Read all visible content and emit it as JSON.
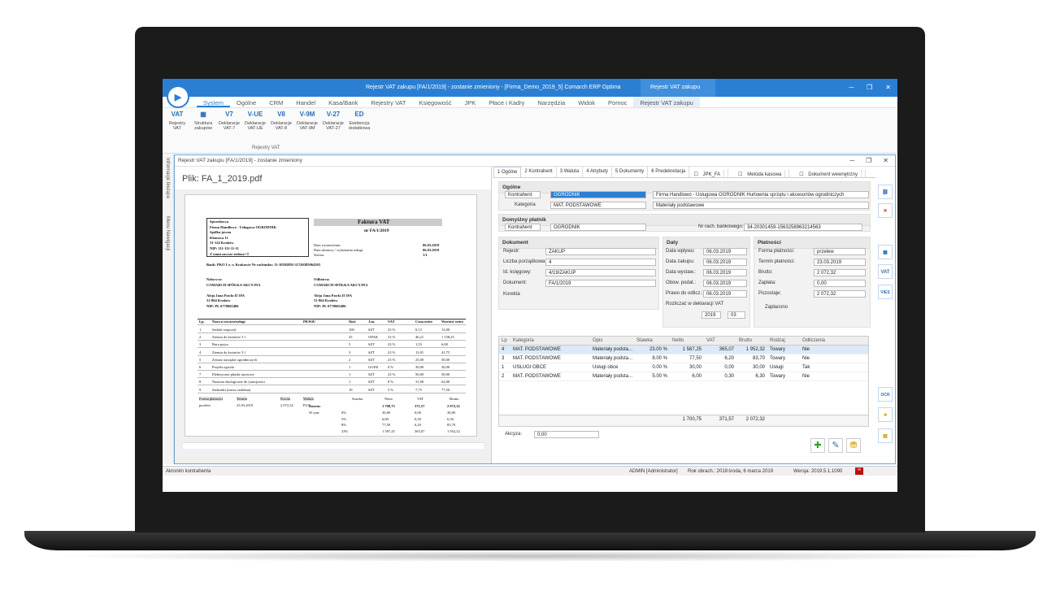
{
  "window": {
    "title": "Rejestr VAT zakupu [FA/1/2019] - zostanie zmieniony - [Firma_Demo_2019_5] Comarch ERP Optima",
    "context_tab": "Rejestr VAT zakupu"
  },
  "menu": [
    "System",
    "Ogólne",
    "CRM",
    "Handel",
    "Kasa/Bank",
    "Rejestry VAT",
    "Księgowość",
    "JPK",
    "Płace i Kadry",
    "Narzędzia",
    "Widok",
    "Pomoc",
    "Rejestr VAT zakupu"
  ],
  "ribbon": {
    "buttons": [
      {
        "icon": "VAT",
        "label": "Rejestry VAT"
      },
      {
        "icon": "",
        "label": "Struktura zakupów"
      },
      {
        "icon": "V7",
        "label": "Deklaracje VAT-7"
      },
      {
        "icon": "V-UE",
        "label": "Deklaracje VAT-UE"
      },
      {
        "icon": "V8",
        "label": "Deklaracje VAT-8"
      },
      {
        "icon": "V-9M",
        "label": "Deklaracje VAT-9M"
      },
      {
        "icon": "V-27",
        "label": "Deklaracje VAT-27"
      },
      {
        "icon": "ED",
        "label": "Ewidencja dodatkowa"
      }
    ],
    "group": "Rejestry VAT"
  },
  "left_strip": [
    "Informacje bieżące",
    "Menu Nawigacji"
  ],
  "subwindow": {
    "title": "Rejestr VAT zakupu [FA/1/2019] - zostanie zmieniony"
  },
  "pdf": {
    "file": "Plik: FA_1_2019.pdf",
    "seller_block": [
      "Sprzedawca",
      "Firma Handlowo - Usługowa OGRODNIK",
      "Spółka jawna",
      "Klonowa 11",
      "31-124 Kraków",
      "NIP: 111-111-11-11",
      "Z nami zawsze zielono !!!"
    ],
    "invoice_title": "Faktura VAT",
    "invoice_no": "nr FA/1/2019",
    "meta": [
      [
        "Data wystawienia:",
        "06.03.2019"
      ],
      [
        "Data dostawy / wykonania usługi:",
        "06.03.2019"
      ],
      [
        "Strona:",
        "1/1"
      ]
    ],
    "bank": "Bank: PKO I o. w Krakowie  Nr rachunku: 11-10202892-31740385064303",
    "buyer": [
      "Nabywca:",
      "COMARCH SPÓŁKA AKCYJNA",
      "",
      "Aleja Jana Pawła II 39A",
      "31-864 Kraków",
      "NIP: PL 6770065406"
    ],
    "receiver": [
      "Odbiorca:",
      "COMARCH SPÓŁKA AKCYJNA",
      "",
      "Aleja Jana Pawła II 39A",
      "31-864 Kraków",
      "NIP: PL 6770065406"
    ],
    "table_head": [
      "Lp.",
      "Nazwa towaru/usługi",
      "PKWiU",
      "Ilość",
      "J.m.",
      "VAT",
      "Cena netto",
      "Wartość netto"
    ],
    "rows": [
      [
        "1",
        "Sadzki rzepczyk",
        "",
        "100",
        "SZT",
        "23 %",
        "0,13",
        "13,00"
      ],
      [
        "2",
        "Ziemia do kwiatów 5 l",
        "",
        "25",
        "OPAK",
        "23 %",
        "46,21",
        "1 158,25"
      ],
      [
        "3",
        "Rura pojca",
        "",
        "5",
        "SZT",
        "23 %",
        "1,53",
        "6,00"
      ],
      [
        "4",
        "Ziemia do kwiatów 5 l",
        "",
        "3",
        "SZT",
        "23 %",
        "13,91",
        "41,75"
      ],
      [
        "5",
        "Zestaw narzędzi ogrodniczych",
        "",
        "2",
        "SZT",
        "23 %",
        "25,00",
        "50,00"
      ],
      [
        "6",
        "Projekt ogrodu",
        "",
        "1",
        "GODZ",
        "0 %",
        "30,00",
        "30,00"
      ],
      [
        "7",
        "Elektryczne pilarki tarczowe",
        "",
        "1",
        "SZT",
        "23 %",
        "50,00",
        "50,00"
      ],
      [
        "8",
        "Nasiona ekologiczne do tynacjności",
        "",
        "1",
        "SZT",
        "8 %",
        "31,00",
        "62,00"
      ],
      [
        "9",
        "Sadzonki (trawa ozdobna)",
        "",
        "10",
        "SZT",
        "5 %",
        "7,75",
        "77,50"
      ]
    ],
    "payment": [
      [
        "Forma płatności",
        "Termin",
        "Kwota",
        "Waluta"
      ],
      [
        "przelew",
        "23.03.2019",
        "2 072,32",
        "PLN"
      ]
    ],
    "summary_head": [
      "",
      "Stawka",
      "Netto",
      "VAT",
      "Brutto"
    ],
    "summary": [
      [
        "Razem:",
        "",
        "1 700,75",
        "371,57",
        "2 072,32"
      ],
      [
        "W tym:",
        "0%",
        "30,00",
        "0,00",
        "30,00"
      ],
      [
        "",
        "5%",
        "6,00",
        "0,30",
        "6,30"
      ],
      [
        "",
        "8%",
        "77,50",
        "6,20",
        "83,70"
      ],
      [
        "",
        "23%",
        "1 587,25",
        "365,07",
        "1 952,32"
      ]
    ]
  },
  "form": {
    "tabs": [
      "1 Ogólne",
      "2 Kontrahent",
      "3 Waluta",
      "4 Atrybuty",
      "5 Dokumenty",
      "6 Predekretacja"
    ],
    "checks": [
      "JPK_FA",
      "Metoda kasowa",
      "Dokument wewnętrzny"
    ],
    "ogolne": {
      "title": "Ogólne",
      "kontrahent_lbl": "Kontrahent",
      "kontrahent": "OGRODNIK",
      "kontrahent_name": "Firma Handlowo - Usługowa OGRODNIK Hurtownia sprzętu i akcesoriów ogrodniczych",
      "kategoria_lbl": "Kategoria",
      "kategoria": "MAT. PODSTAWOWE",
      "kategoria_desc": "Materiały podstawowe"
    },
    "platnik": {
      "title": "Domyślny płatnik",
      "type": "Kontrahent",
      "value": "OGRODNIK",
      "bank_lbl": "Nr rach. bankowego:",
      "bank": "34-20301459-1563258963214563"
    },
    "dokument": {
      "title": "Dokument",
      "rejestr_lbl": "Rejestr:",
      "rejestr": "ZAKUP",
      "lp_lbl": "Liczba porządkowa:",
      "lp": "4",
      "idk_lbl": "Id. księgowy:",
      "idk": "4/19/ZAKUP",
      "dok_lbl": "Dokument:",
      "dok": "FA/1/2019",
      "korekta": "Korekta"
    },
    "daty": {
      "title": "Daty",
      "rows": [
        [
          "Data wpływu:",
          "06.03.2019"
        ],
        [
          "Data zakupu:",
          "06.03.2019"
        ],
        [
          "Data wystaw.:",
          "06.03.2019"
        ],
        [
          "Obow. podat.:",
          "06.03.2019"
        ],
        [
          "Prawo do odlicz.:",
          "06.03.2019"
        ]
      ],
      "rozliczac": "Rozliczać w deklaracji VAT",
      "year": "2019",
      "month": "03"
    },
    "platnosci": {
      "title": "Płatności",
      "forma_lbl": "Forma płatności:",
      "forma": "przelew",
      "termin_lbl": "Termin płatności:",
      "termin": "23.03.2019",
      "brutto_lbl": "Brutto:",
      "brutto": "2 072,32",
      "zaplata_lbl": "Zapłata:",
      "zaplata": "0,00",
      "pozostaje_lbl": "Pozostaje:",
      "pozostaje": "2 072,32",
      "zaplacono": "Zapłacono"
    },
    "grid": {
      "head": [
        "Lp",
        "Kategoria",
        "Opis",
        "Stawka",
        "Netto",
        "VAT",
        "Brutto",
        "Rodzaj",
        "Odliczenia"
      ],
      "rows": [
        [
          "4",
          "MAT. PODSTAWOWE",
          "Materiały podsta...",
          "23.00 %",
          "1 587,25",
          "365,07",
          "1 952,32",
          "Towary",
          "Nie"
        ],
        [
          "3",
          "MAT. PODSTAWOWE",
          "Materiały podsta...",
          "8.00 %",
          "77,50",
          "6,20",
          "83,70",
          "Towary",
          "Nie"
        ],
        [
          "1",
          "USŁUGI OBCE",
          "Usługi obce",
          "0.00 %",
          "30,00",
          "0,00",
          "30,00",
          "Usługi",
          "Tak"
        ],
        [
          "2",
          "MAT. PODSTAWOWE",
          "Materiały podsta...",
          "5.00 %",
          "6,00",
          "0,30",
          "6,30",
          "Towary",
          "Nie"
        ]
      ],
      "sum": [
        "1 700,75",
        "371,57",
        "2 072,32"
      ]
    },
    "akcyza_lbl": "Akcyza:",
    "akcyza": "0,00"
  },
  "status": {
    "left": "Akronim kontrahenta",
    "user": "ADMIN [Administrator]",
    "year": "Rok obrach.: 2018",
    "date": "środa, 6 marca 2019",
    "version": "Wersja: 2019.5.1.1090"
  },
  "colors": {
    "accent": "#2b7fd3",
    "selection": "#dbe9f8"
  }
}
